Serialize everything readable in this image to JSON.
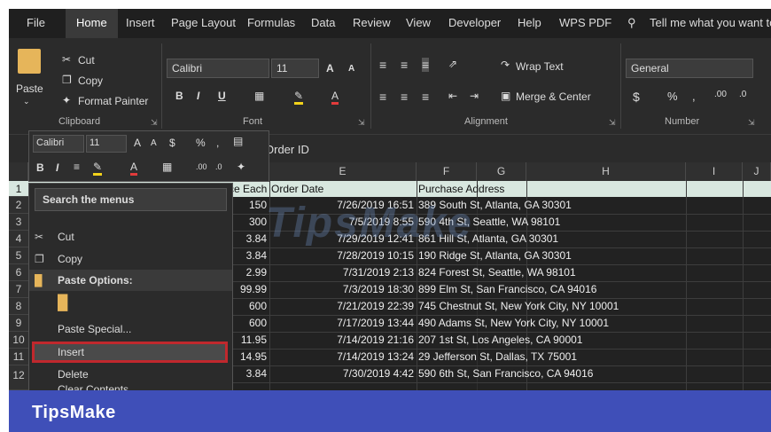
{
  "tabs": [
    "File",
    "Home",
    "Insert",
    "Page Layout",
    "Formulas",
    "Data",
    "Review",
    "View",
    "Developer",
    "Help",
    "WPS PDF"
  ],
  "active_tab": "Home",
  "tell_me": "Tell me what you want to",
  "clipboard": {
    "paste": "Paste",
    "cut": "Cut",
    "copy": "Copy",
    "format_painter": "Format Painter",
    "group": "Clipboard"
  },
  "font": {
    "name": "Calibri",
    "size": "11",
    "group": "Font",
    "bold": "B",
    "italic": "I",
    "underline": "U",
    "grow": "A",
    "shrink": "A"
  },
  "alignment": {
    "wrap": "Wrap Text",
    "merge": "Merge & Center",
    "group": "Alignment"
  },
  "number": {
    "format": "General",
    "currency": "$",
    "percent": "%",
    "comma": ",",
    "group": "Number"
  },
  "mini_toolbar": {
    "font": "Calibri",
    "size": "11",
    "dollar": "$",
    "percent": "%",
    "comma": ",",
    "bold": "B",
    "italic": "I"
  },
  "formula_bar": {
    "content": "Order ID"
  },
  "columns": [
    "E",
    "F",
    "G",
    "H",
    "I",
    "J"
  ],
  "row_numbers": [
    "1",
    "2",
    "3",
    "4",
    "5",
    "6",
    "7",
    "8",
    "9",
    "10",
    "11",
    "12"
  ],
  "header_row": {
    "col_d_partial": "ce Each",
    "order_date": "Order Date",
    "purchase_address": "Purchase Address"
  },
  "rows": [
    {
      "price": "150",
      "date": "7/26/2019 16:51",
      "address": "389 South St, Atlanta, GA 30301"
    },
    {
      "price": "300",
      "date": "7/5/2019 8:55",
      "address": "590 4th St, Seattle, WA 98101"
    },
    {
      "price": "3.84",
      "date": "7/29/2019 12:41",
      "address": "861 Hill St, Atlanta, GA 30301"
    },
    {
      "price": "3.84",
      "date": "7/28/2019 10:15",
      "address": "190 Ridge St, Atlanta, GA 30301"
    },
    {
      "price": "2.99",
      "date": "7/31/2019 2:13",
      "address": "824 Forest St, Seattle, WA 98101"
    },
    {
      "price": "99.99",
      "date": "7/3/2019 18:30",
      "address": "899 Elm St, San Francisco, CA 94016"
    },
    {
      "price": "600",
      "date": "7/21/2019 22:39",
      "address": "745 Chestnut St, New York City, NY 10001"
    },
    {
      "price": "600",
      "date": "7/17/2019 13:44",
      "address": "490 Adams St, New York City, NY 10001"
    },
    {
      "price": "11.95",
      "date": "7/14/2019 21:16",
      "address": "207 1st St, Los Angeles, CA 90001"
    },
    {
      "price": "14.95",
      "date": "7/14/2019 13:24",
      "address": "29 Jefferson St, Dallas, TX 75001"
    },
    {
      "price": "3.84",
      "date": "7/30/2019 4:42",
      "address": "590 6th St, San Francisco, CA 94016"
    }
  ],
  "context_menu": {
    "search": "Search the menus",
    "cut": "Cut",
    "copy": "Copy",
    "paste_options": "Paste Options:",
    "paste_special": "Paste Special...",
    "insert": "Insert",
    "delete": "Delete",
    "clear": "Clear Contents"
  },
  "watermark": "TipsMake",
  "footer_brand": "TipsMake",
  "colors": {
    "highlight": "#c0282d",
    "footer": "#3f4fb8",
    "header_row": "#d8e7df"
  }
}
